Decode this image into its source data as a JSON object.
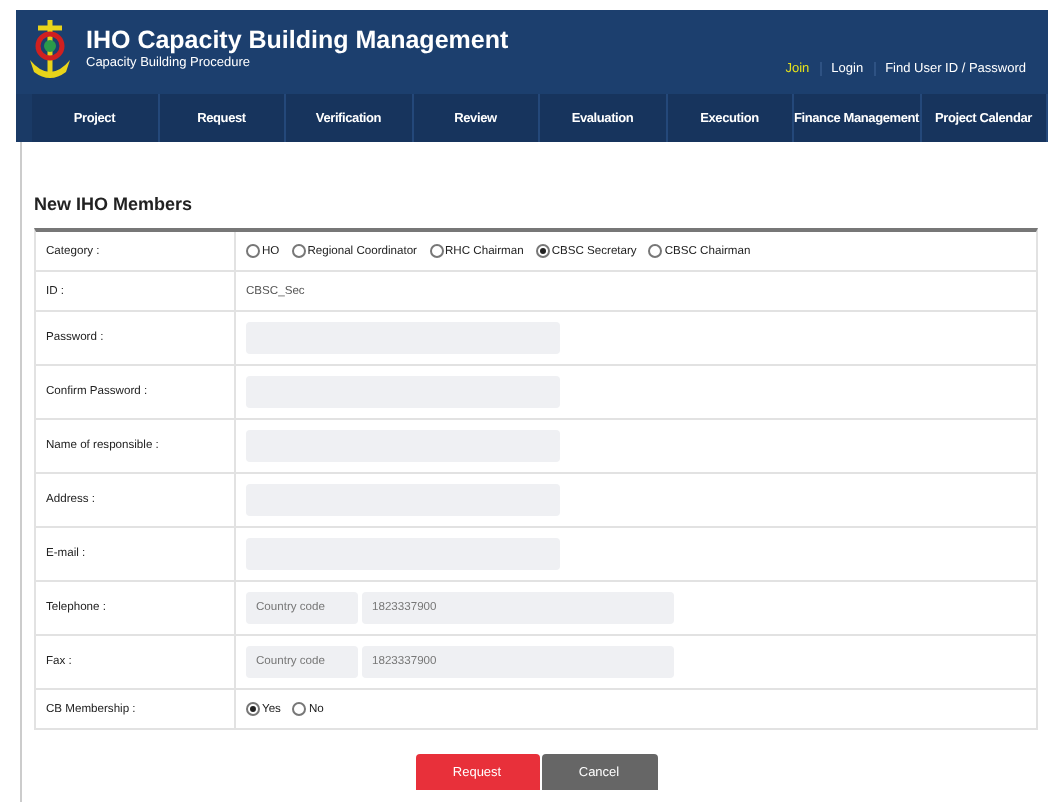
{
  "header": {
    "title": "IHO Capacity Building Management",
    "subtitle": "Capacity Building Procedure",
    "links": [
      {
        "label": "Join",
        "highlighted": true
      },
      {
        "label": "Login",
        "highlighted": false
      },
      {
        "label": "Find User ID / Password",
        "highlighted": false
      }
    ]
  },
  "nav": [
    "Project",
    "Request",
    "Verification",
    "Review",
    "Evaluation",
    "Execution",
    "Finance Management",
    "Project Calendar"
  ],
  "form": {
    "title": "New IHO Members",
    "rows": [
      {
        "kind": "radio",
        "label": "Category :",
        "options": [
          {
            "label": "HO",
            "selected": false
          },
          {
            "label": "Regional Coordinator",
            "selected": false
          },
          {
            "label": "RHC Chairman",
            "selected": false
          },
          {
            "label": "CBSC Secretary",
            "selected": true
          },
          {
            "label": "CBSC Chairman",
            "selected": false
          }
        ]
      },
      {
        "kind": "text",
        "label": "ID :",
        "value": "CBSC_Sec"
      },
      {
        "kind": "input",
        "label": "Password :"
      },
      {
        "kind": "input",
        "label": "Confirm Password :"
      },
      {
        "kind": "input",
        "label": "Name of responsible :"
      },
      {
        "kind": "input",
        "label": "Address :"
      },
      {
        "kind": "input",
        "label": "E-mail :"
      },
      {
        "kind": "phone",
        "label": "Telephone :",
        "placeholder": "Country code",
        "value": "1823337900"
      },
      {
        "kind": "phone",
        "label": "Fax :",
        "placeholder": "Country code",
        "value": "1823337900"
      },
      {
        "kind": "radio",
        "label": "CB Membership :",
        "options": [
          {
            "label": "Yes",
            "selected": true
          },
          {
            "label": "No",
            "selected": false
          }
        ]
      }
    ]
  },
  "buttons": [
    {
      "label": "Request",
      "kind": "primary"
    },
    {
      "label": "Cancel",
      "kind": "secondary"
    }
  ]
}
